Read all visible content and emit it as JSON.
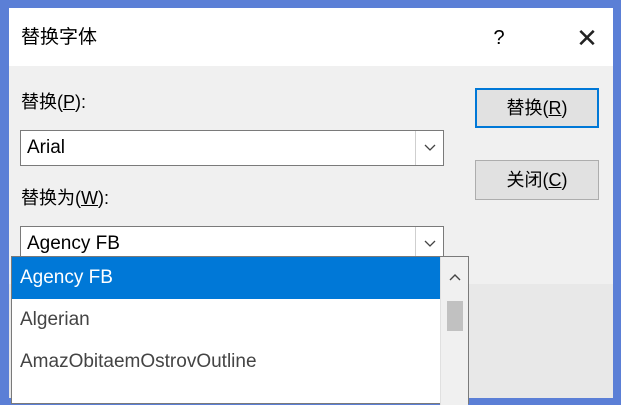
{
  "dialog": {
    "title": "替换字体",
    "help": "?",
    "close": "✕"
  },
  "form": {
    "replace_label_prefix": "替换(",
    "replace_label_key": "P",
    "replace_label_suffix": "):",
    "replace_value": "Arial",
    "with_label_prefix": "替换为(",
    "with_label_key": "W",
    "with_label_suffix": "):",
    "with_value": "Agency FB"
  },
  "buttons": {
    "replace_prefix": "替换(",
    "replace_key": "R",
    "replace_suffix": ")",
    "close_prefix": "关闭(",
    "close_key": "C",
    "close_suffix": ")"
  },
  "dropdown": {
    "items": [
      "Agency FB",
      "Algerian",
      "AmazObitaemOstrovOutline"
    ],
    "selected_index": 0
  },
  "colors": {
    "accent": "#0078d7",
    "backdrop": "#5b7fd6"
  },
  "icons": {
    "dropdown_arrow": "chevron-down-icon",
    "scroll_up": "chevron-up-icon",
    "close": "close-icon"
  }
}
